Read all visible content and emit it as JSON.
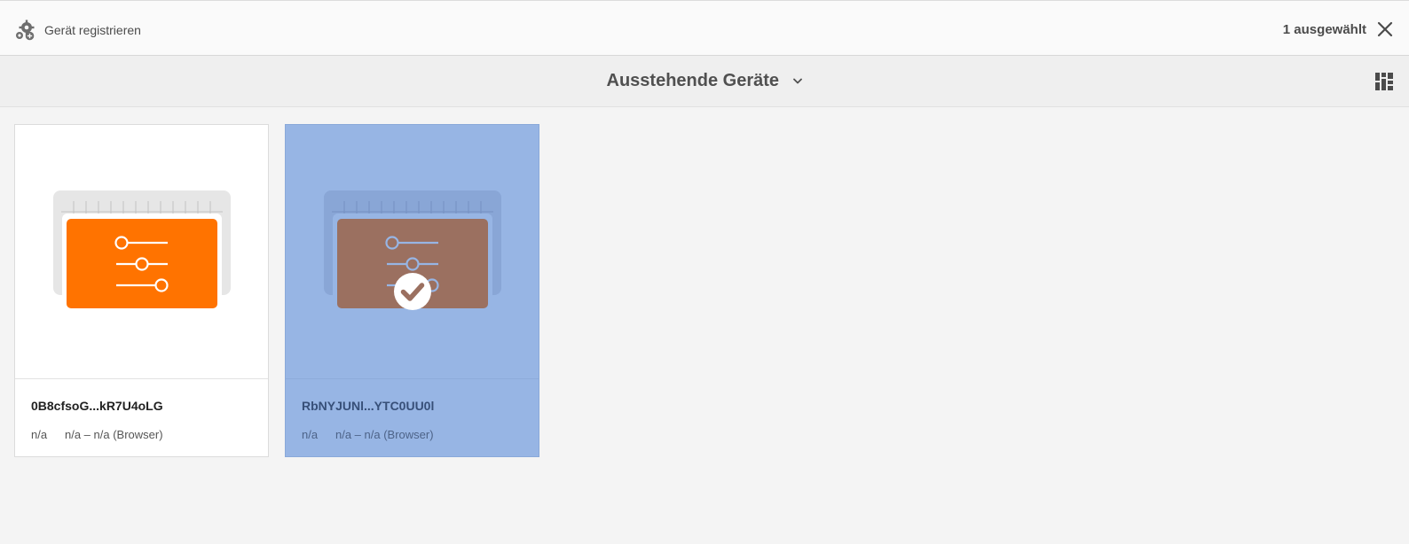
{
  "actionbar": {
    "register_label": "Gerät registrieren",
    "selection_count": "1 ausgewählt"
  },
  "titlebar": {
    "title": "Ausstehende Geräte"
  },
  "cards": [
    {
      "name": "0B8cfsoG...kR7U4oLG",
      "field1": "n/a",
      "field2": "n/a – n/a (Browser)",
      "selected": false,
      "accent": "#ff7300"
    },
    {
      "name": "RbNYJUNl...YTC0UU0l",
      "field1": "n/a",
      "field2": "n/a – n/a (Browser)",
      "selected": true,
      "accent": "#9b7060"
    }
  ],
  "colors": {
    "selection": "#97b5e4",
    "device_orange": "#ff7300"
  },
  "icons": [
    "gear-add-icon",
    "close-icon",
    "chevron-down-icon",
    "card-view-icon",
    "device-settings-icon",
    "checkmark-icon"
  ]
}
